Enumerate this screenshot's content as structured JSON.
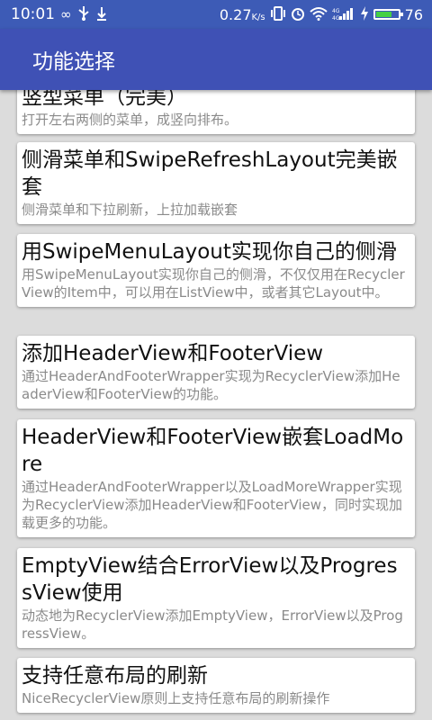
{
  "status_bar": {
    "time": "10:01",
    "net_speed": "0.27",
    "net_speed_unit": "K/s",
    "battery_level": "76",
    "battery_fraction": 0.76,
    "battery_color": "#44d044",
    "icons": [
      "infinity-icon",
      "usb-icon",
      "vibrate-icon",
      "alarm-icon",
      "wifi-icon",
      "signal-icon",
      "charging-icon",
      "battery-icon"
    ]
  },
  "app_bar": {
    "title": "功能选择",
    "color": "#3f51b5"
  },
  "items": [
    {
      "title": "竖型菜单（完美）",
      "desc": "打开左右两侧的菜单，成竖向排布。"
    },
    {
      "title": "侧滑菜单和SwipeRefreshLayout完美嵌套",
      "desc": "侧滑菜单和下拉刷新，上拉加载嵌套"
    },
    {
      "title": "用SwipeMenuLayout实现你自己的侧滑",
      "desc": "用SwipeMenuLayout实现你自己的侧滑，不仅仅用在RecyclerView的Item中，可以用在ListView中，或者其它Layout中。"
    },
    {
      "title": "添加HeaderView和FooterView",
      "desc": "通过HeaderAndFooterWrapper实现为RecyclerView添加HeaderView和FooterView的功能。"
    },
    {
      "title": "HeaderView和FooterView嵌套LoadMore",
      "desc": "通过HeaderAndFooterWrapper以及LoadMoreWrapper实现为RecyclerView添加HeaderView和FooterView，同时实现加载更多的功能。"
    },
    {
      "title": "EmptyView结合ErrorView以及ProgressView使用",
      "desc": "动态地为RecyclerView添加EmptyView，ErrorView以及ProgressView。"
    },
    {
      "title": "支持任意布局的刷新",
      "desc": "NiceRecyclerView原则上支持任意布局的刷新操作"
    }
  ]
}
